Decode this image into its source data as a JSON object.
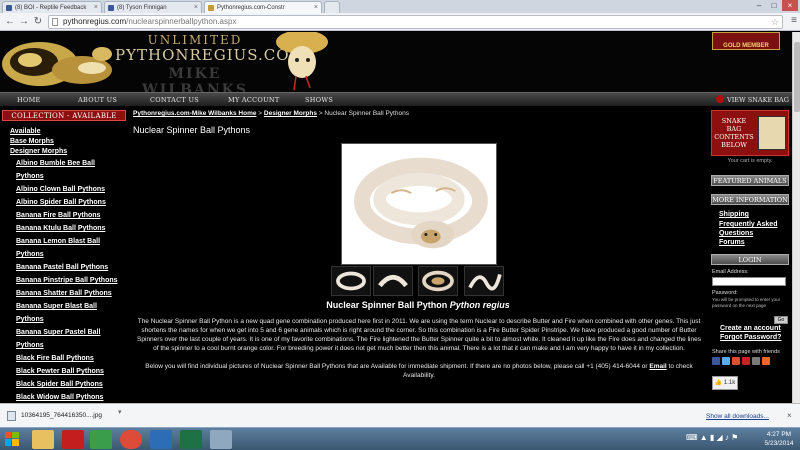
{
  "browser": {
    "tabs": [
      {
        "label": "(8) BOI - Reptile Feedback",
        "icon_color": "#3b5998",
        "active": false
      },
      {
        "label": "(8) Tyson Finnigan",
        "icon_color": "#3b5998",
        "active": false
      },
      {
        "label": "Pythonregius.com-Constr",
        "icon_color": "#c49a3a",
        "active": true
      }
    ],
    "url_host": "pythonregius.com",
    "url_path": "/nuclearspinnerballpython.aspx",
    "back_icon": "back-arrow-icon",
    "forward_icon": "forward-arrow-icon",
    "reload_icon": "reload-icon"
  },
  "header": {
    "logo_line1": "UNLIMITED",
    "logo_line2": "PYTHONREGIUS.COM",
    "logo_line3": "MIKE WILBANKS",
    "badge": "GOLD MEMBER"
  },
  "nav": {
    "items": [
      "HOME",
      "ABOUT US",
      "CONTACT US",
      "MY ACCOUNT",
      "SHOWS"
    ],
    "view_bag": "VIEW SNAKE BAG"
  },
  "left": {
    "heading": "COLLECTION - AVAILABLE",
    "top_links": [
      "Available",
      "Base Morphs",
      "Designer Morphs"
    ],
    "morph_links": [
      "Albino Bumble Bee Ball",
      "Pythons",
      "Albino Clown Ball Pythons",
      "Albino Spider Ball Pythons",
      "Banana Fire Ball Pythons",
      "Banana Ktulu Ball Pythons",
      "Banana Lemon Blast Ball",
      "Pythons",
      "Banana Pastel Ball Pythons",
      "Banana Pinstripe Ball Pythons",
      "Banana Shatter Ball Pythons",
      "Banana Super Blast Ball",
      "Pythons",
      "Banana Super Pastel Ball",
      "Pythons",
      "Black Fire Ball Pythons",
      "Black Pewter Ball Pythons",
      "Black Spider Ball Pythons",
      "Black Widow Ball Pythons"
    ]
  },
  "main": {
    "crumb_home": "Pythonregius.com-Mike Wilbanks Home",
    "crumb_sep1": " > ",
    "crumb_cat": "Designer Morphs",
    "crumb_sep2": " > ",
    "crumb_current": "Nuclear Spinner Ball Pythons",
    "title": "Nuclear Spinner Ball Pythons",
    "caption_plain": "Nuclear Spinner Ball Python ",
    "caption_italic": "Python regius",
    "description": "The Nuclear Spinner Ball Python is a new quad gene combination produced here first in 2011.  We are using the term Nuclear to describe Butter and Fire when combined with other genes.  This just shortens the names for when we get into 5 and 6 gene animals which is right around the corner.  So this combination is a Fire Butter Spider Pinstripe.  We have produced a good number of Butter Spinners over the last couple of years.  It is one of my favorite combinations.  The Fire lightened the Butter Spinner quite a bit to almost white.  It cleaned it up like the Fire does and changed the lines of the spinner to a cool burnt orange color.  For breeding power it does not get much better then this animal.  There is a lot that it can make and I am very happy to have it in my collection.",
    "below_text": "Below you will find individual pictures of Nuclear Spinner Ball Pythons that are Available for immediate shipment.  If there are no photos below, please call +1 (405) 414-6044 or ",
    "email_link": "Email",
    "below_text_end": " to check Availability."
  },
  "right": {
    "bag_title": "SNAKE BAG CONTENTS BELOW",
    "cart_empty": "Your cart is empty.",
    "featured": "FEATURED ANIMALS",
    "more_info": "MORE INFORMATION",
    "info_links": [
      "Shipping",
      "Frequently Asked",
      "Questions",
      "Forums"
    ],
    "login_head": "LOGIN",
    "email_label": "Email Address:",
    "password_label": "Password:",
    "password_note": "You will be prompted to enter your password on the next page",
    "go_label": "Go",
    "create_account": "Create an account",
    "forgot_password": "Forgot Password?",
    "share_label": "Share this page with friends",
    "like_count": "1.1k"
  },
  "downloads": {
    "file": "10364195_764416350....jpg",
    "show_all": "Show all downloads..."
  },
  "taskbar": {
    "time": "4:27 PM",
    "date": "5/23/2014"
  }
}
